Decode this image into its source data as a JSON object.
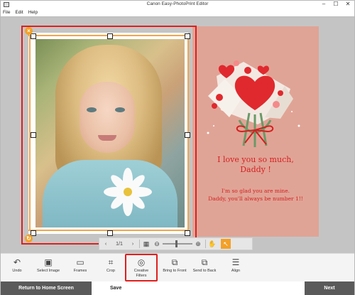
{
  "window": {
    "title": "Canon Easy-PhotoPrint Editor",
    "minimize": "–",
    "maximize": "☐",
    "close": "✕"
  },
  "menu": [
    "File",
    "Edit",
    "Help"
  ],
  "card": {
    "line1": "I love you so much,",
    "line2": "Daddy !",
    "line3": "I'm so glad you are mine.",
    "line4": "Daddy, you'll always be number 1!!"
  },
  "page_nav": {
    "page": "1/1"
  },
  "toolbar": [
    {
      "label": "Undo"
    },
    {
      "label": "Select Image"
    },
    {
      "label": "Frames"
    },
    {
      "label": "Crop"
    },
    {
      "label": "Creative Filters"
    },
    {
      "label": "Bring to Front"
    },
    {
      "label": "Send to Back"
    },
    {
      "label": "Align"
    }
  ],
  "footer": {
    "home": "Return to Home Screen",
    "save": "Save",
    "next": "Next"
  },
  "colors": {
    "selection": "#e01e1e",
    "accent": "#f3a028",
    "card_bg": "#e0a496"
  }
}
